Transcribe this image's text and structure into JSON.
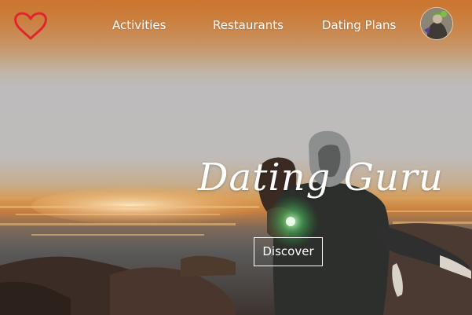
{
  "nav": {
    "logo_icon": "heart-icon",
    "links": [
      {
        "label": "Activities"
      },
      {
        "label": "Restaurants"
      },
      {
        "label": "Dating Plans"
      }
    ],
    "avatar_icon": "user-avatar-icon"
  },
  "hero": {
    "title": "Dating Guru",
    "button_label": "Discover"
  },
  "colors": {
    "logo": "#e0262c",
    "text": "#ffffff",
    "sunset": "#d98a3c",
    "sky": "#bdbbbb"
  }
}
